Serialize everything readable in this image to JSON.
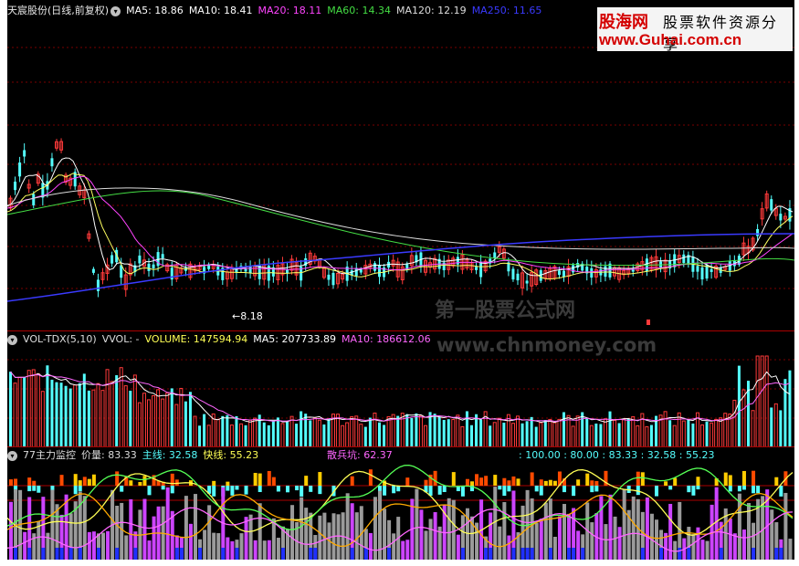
{
  "price_panel": {
    "title": "天宸股份(日线,前复权)",
    "ma": [
      {
        "label": "MA5: 18.86",
        "color": "#ffffff"
      },
      {
        "label": "MA10: 18.41",
        "color": "#ffffff"
      },
      {
        "label": "MA20: 18.11",
        "color": "#ff44ff"
      },
      {
        "label": "MA60: 14.34",
        "color": "#44dd44"
      },
      {
        "label": "MA120: 12.19",
        "color": "#dddddd"
      },
      {
        "label": "MA250: 11.65",
        "color": "#3a3aff"
      }
    ],
    "low_marker": "8.18"
  },
  "volume_panel": {
    "items": [
      {
        "label": "VOL-TDX(5,10)",
        "color": "#dddddd"
      },
      {
        "label": "VVOL: -",
        "color": "#dddddd"
      },
      {
        "label": "VOLUME: 147594.94",
        "color": "#ffff55"
      },
      {
        "label": "MA5: 207733.89",
        "color": "#ffffff"
      },
      {
        "label": "MA10: 186612.06",
        "color": "#ff66ff"
      }
    ]
  },
  "indicator_panel": {
    "items": [
      {
        "label": "77主力监控",
        "color": "#dddddd"
      },
      {
        "label": "价量: 83.33",
        "color": "#dddddd"
      },
      {
        "label": "主线: 32.58",
        "color": "#55ffff"
      },
      {
        "label": "快线: 55.23",
        "color": "#ffff55"
      }
    ],
    "san_bing": "散兵坑: 62.37",
    "right_values": ": 100.00  : 80.00  : 83.33  : 32.58  : 55.23"
  },
  "logo": {
    "line1_main": "股海网",
    "line1_sub": "股票软件资源分享",
    "line2": "www.Guhai.com.cn"
  },
  "watermark": {
    "line1": "第一股票公式网",
    "line2": "www.chnmoney.com"
  }
}
